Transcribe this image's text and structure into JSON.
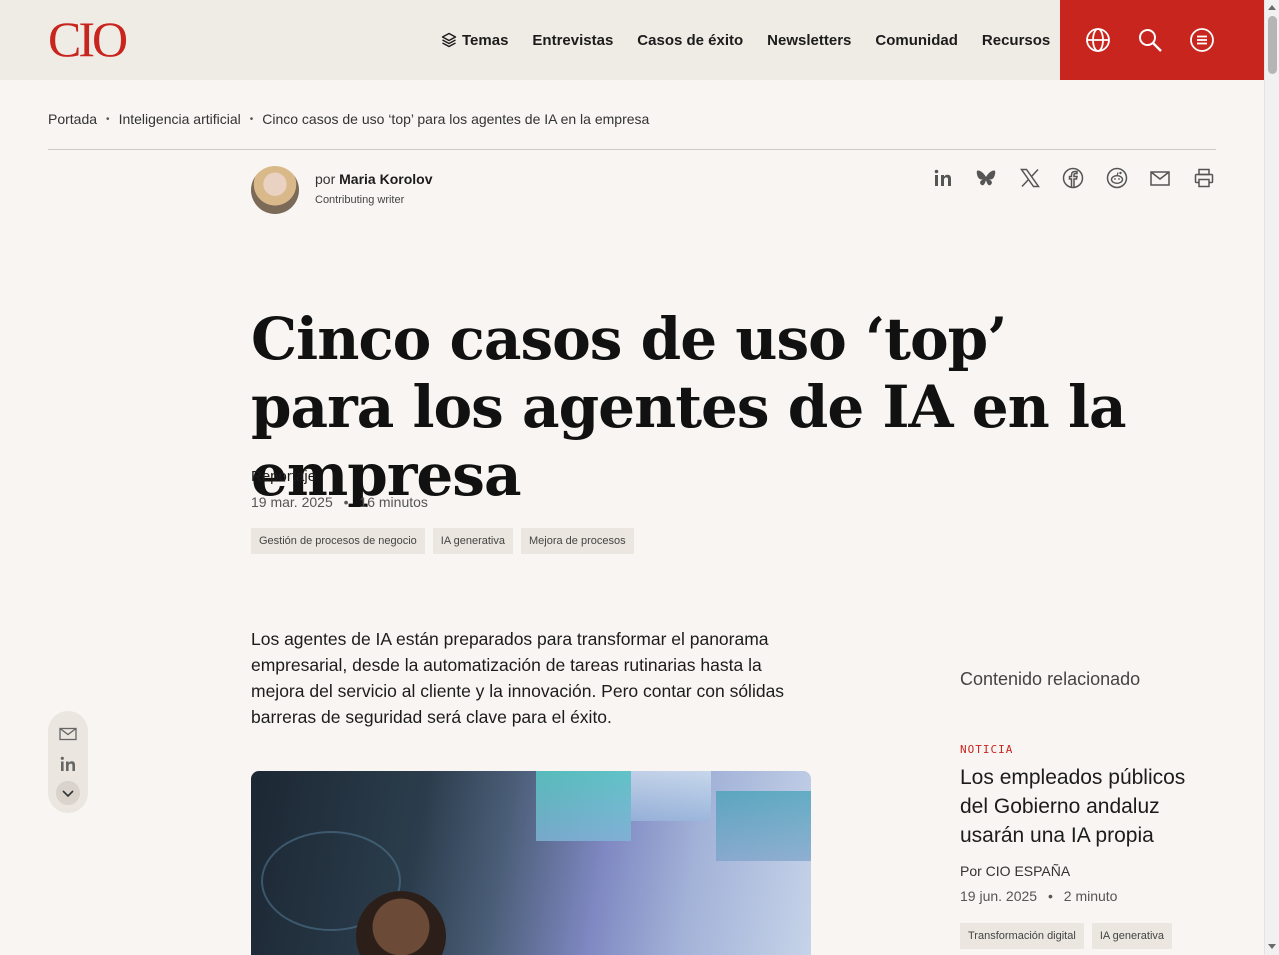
{
  "header": {
    "logo": "CIO",
    "nav": [
      "Temas",
      "Entrevistas",
      "Casos de éxito",
      "Newsletters",
      "Comunidad",
      "Recursos"
    ],
    "accent_color": "#c8251e"
  },
  "breadcrumb": {
    "items": [
      "Portada",
      "Inteligencia artificial",
      "Cinco casos de uso ‘top’ para los agentes de IA en la empresa"
    ],
    "separator": "•"
  },
  "author": {
    "prefix": "por",
    "name": "Maria Korolov",
    "role": "Contributing writer"
  },
  "share_icons": [
    "linkedin-icon",
    "bluesky-icon",
    "x-icon",
    "facebook-icon",
    "reddit-icon",
    "email-icon",
    "print-icon"
  ],
  "article": {
    "title": "Cinco casos de uso ‘top’ para los agentes de IA en la empresa",
    "kind": "Reportaje",
    "date": "19 mar. 2025",
    "dot": "•",
    "reading_time": "16 minutos",
    "tags": [
      "Gestión de procesos de negocio",
      "IA generativa",
      "Mejora de procesos"
    ],
    "lead": "Los agentes de IA están preparados para transformar el panorama empresarial, desde la automatización de tareas rutinarias hasta la mejora del servicio al cliente y la innovación. Pero contar con sólidas barreras de seguridad será clave para el éxito."
  },
  "related": {
    "heading": "Contenido relacionado",
    "item": {
      "type": "NOTICIA",
      "headline": "Los empleados públicos del Gobierno andaluz usarán una IA propia",
      "by": "Por CIO ESPAÑA",
      "date": "19 jun. 2025",
      "dot": "•",
      "reading_time": "2 minuto",
      "tags": [
        "Transformación digital",
        "IA generativa"
      ]
    }
  }
}
